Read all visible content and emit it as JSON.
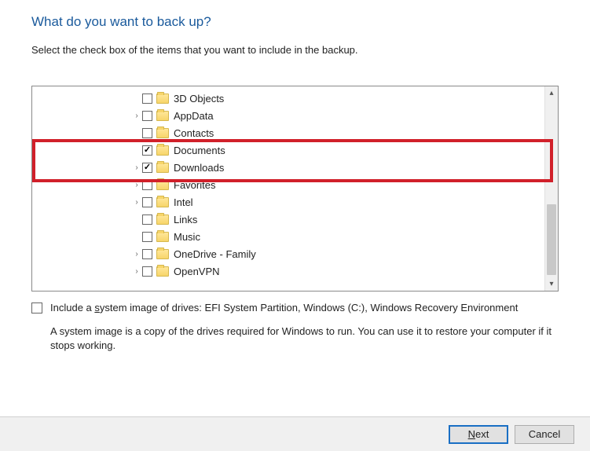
{
  "title": "What do you want to back up?",
  "subtitle": "Select the check box of the items that you want to include in the backup.",
  "tree": [
    {
      "label": "3D Objects",
      "checked": false,
      "expand": false
    },
    {
      "label": "AppData",
      "checked": false,
      "expand": true
    },
    {
      "label": "Contacts",
      "checked": false,
      "expand": false
    },
    {
      "label": "Documents",
      "checked": true,
      "expand": false
    },
    {
      "label": "Downloads",
      "checked": true,
      "expand": true
    },
    {
      "label": "Favorites",
      "checked": false,
      "expand": true
    },
    {
      "label": "Intel",
      "checked": false,
      "expand": true
    },
    {
      "label": "Links",
      "checked": false,
      "expand": false
    },
    {
      "label": "Music",
      "checked": false,
      "expand": false
    },
    {
      "label": "OneDrive - Family",
      "checked": false,
      "expand": true
    },
    {
      "label": "OpenVPN",
      "checked": false,
      "expand": true
    }
  ],
  "system_image": {
    "label_a": "Include a ",
    "label_u1": "s",
    "label_b": "ystem image of drives: EFI System Partition, Windows (C:), Windows Recovery Environment",
    "desc": "A system image is a copy of the drives required for Windows to run. You can use it to restore your computer if it stops working.",
    "checked": false
  },
  "buttons": {
    "next_u": "N",
    "next_rest": "ext",
    "cancel": "Cancel"
  },
  "highlight_color": "#d1202a"
}
